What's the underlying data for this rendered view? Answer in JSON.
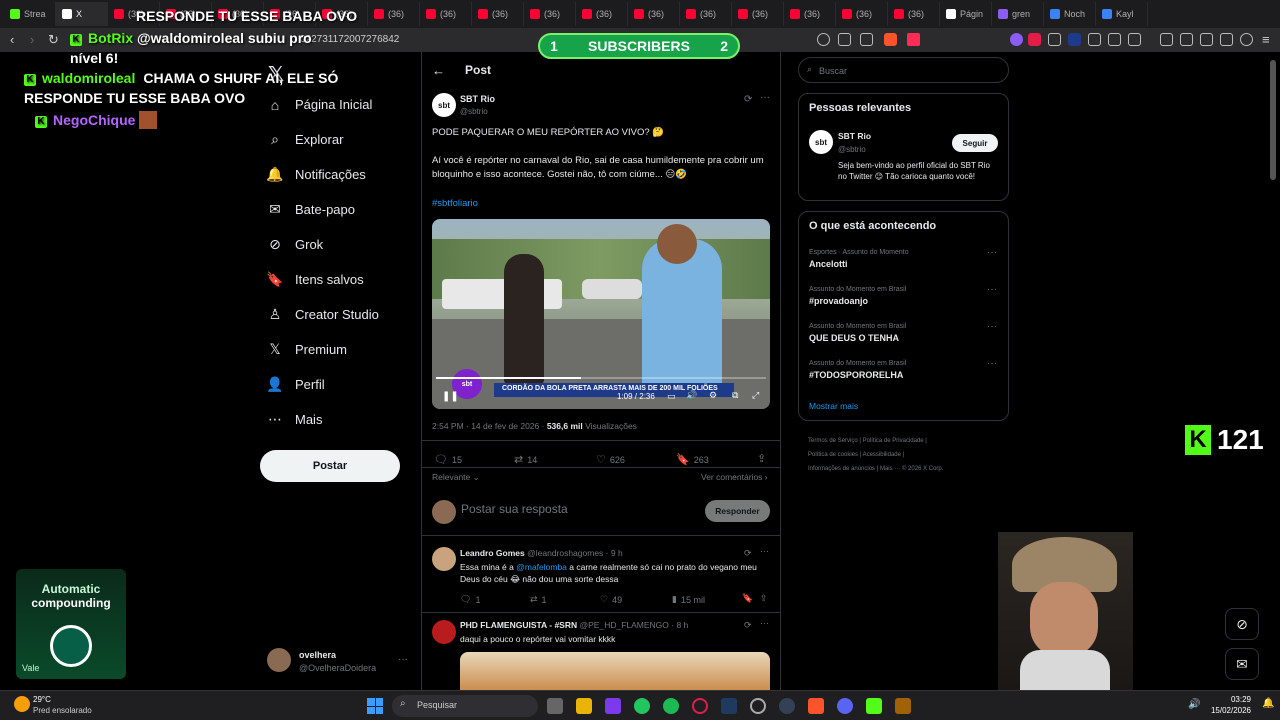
{
  "browser": {
    "tabs": [
      {
        "label": "Strea",
        "color": "#53fc18"
      },
      {
        "label": "X",
        "color": "#ffffff",
        "active": true
      },
      {
        "label": "(36)",
        "color": "#ff0033"
      },
      {
        "label": "(36)",
        "color": "#ff0033"
      },
      {
        "label": "(36)",
        "color": "#ff0033"
      },
      {
        "label": "(36)",
        "color": "#ff0033"
      },
      {
        "label": "(36)",
        "color": "#ff0033"
      },
      {
        "label": "(36)",
        "color": "#ff0033"
      },
      {
        "label": "(36)",
        "color": "#ff0033"
      },
      {
        "label": "(36)",
        "color": "#ff0033"
      },
      {
        "label": "(36)",
        "color": "#ff0033"
      },
      {
        "label": "(36)",
        "color": "#ff0033"
      },
      {
        "label": "(36)",
        "color": "#ff0033"
      },
      {
        "label": "(36)",
        "color": "#ff0033"
      },
      {
        "label": "(36)",
        "color": "#ff0033"
      },
      {
        "label": "(36)",
        "color": "#ff0033"
      },
      {
        "label": "(36)",
        "color": "#ff0033"
      },
      {
        "label": "(36)",
        "color": "#ff0033"
      },
      {
        "label": "Págin",
        "color": "#ffffff"
      },
      {
        "label": "gren",
        "color": "#8b5cf6"
      },
      {
        "label": "Noch",
        "color": "#3b82f6"
      },
      {
        "label": "Kayl",
        "color": "#3b82f6"
      }
    ],
    "url": "022731172007276842"
  },
  "overlay": {
    "chat": [
      {
        "user": "",
        "text": "RESPONDE TU ESSE BABA OVO",
        "color": "#ffffff"
      },
      {
        "user": "BotRix",
        "text": "@waldomiroleal subiu pro nível 6!",
        "color": "#53fc18"
      },
      {
        "user": "waldomiroleal",
        "text": "CHAMA O SHURF AI, ELE SÓ RESPONDE TU ESSE BABA OVO",
        "color": "#53fc18"
      },
      {
        "user": "NegoChique",
        "text": "",
        "color": "#b266ff"
      }
    ],
    "subscribers": {
      "left": "1",
      "label": "SUBSCRIBERS",
      "right": "2"
    },
    "kick_count": "121",
    "promo": {
      "line1": "Automatic",
      "line2": "compounding",
      "brand": "Vale"
    }
  },
  "nav": {
    "items": [
      {
        "label": "Página Inicial",
        "icon": "home-icon"
      },
      {
        "label": "Explorar",
        "icon": "search-icon"
      },
      {
        "label": "Notificações",
        "icon": "bell-icon"
      },
      {
        "label": "Bate-papo",
        "icon": "mail-icon"
      },
      {
        "label": "Grok",
        "icon": "grok-icon"
      },
      {
        "label": "Itens salvos",
        "icon": "bookmark-icon"
      },
      {
        "label": "Creator Studio",
        "icon": "creator-icon"
      },
      {
        "label": "Premium",
        "icon": "x-icon"
      },
      {
        "label": "Perfil",
        "icon": "person-icon"
      },
      {
        "label": "Mais",
        "icon": "more-icon"
      }
    ],
    "post_label": "Postar",
    "account": {
      "name": "ovelhera",
      "handle": "@OvelheraDoidera"
    }
  },
  "post": {
    "header": "Post",
    "author": "SBT Rio",
    "handle": "@sbtrio",
    "text1": "PODE PAQUERAR O MEU REPÓRTER AO VIVO? 🤔",
    "text2": "Aí você é repórter no carnaval do Rio, sai de casa humildemente pra cobrir um bloquinho e isso acontece. Gostei não, tô com ciúme... 😑🤣",
    "hashtag": "#sbtfoliario",
    "video_time": "1:09 / 2:36",
    "video_caption": "CORDÃO DA BOLA PRETA ARRASTA MAIS DE 200 MIL FOLIÕES",
    "video_progress": 0.44,
    "timestamp": "2:54 PM · 14 de fev de 2026 · ",
    "views": "536,6 mil",
    "views_label": " Visualizações",
    "stats": {
      "replies": "15",
      "reposts": "14",
      "likes": "626",
      "bookmarks": "263"
    },
    "sort_label": "Relevante",
    "comments_link": "Ver comentários",
    "reply_placeholder": "Postar sua resposta",
    "reply_button": "Responder"
  },
  "replies": [
    {
      "name": "Leandro Gomes",
      "handle": "@leandroshagomes · 9 h",
      "text_pre": "Essa mina é a ",
      "mention": "@mafelomba",
      "text_post": " a carne realmente só cai no prato do vegano meu Deus do céu 😂 não dou uma sorte dessa",
      "replies": "1",
      "reposts": "1",
      "likes": "49",
      "views": "15 mil"
    },
    {
      "name": "PHD FLAMENGUISTA - #SRN",
      "handle": "@PE_HD_FLAMENGO · 8 h",
      "text_pre": "daqui a pouco o repórter vai vomitar kkkk",
      "mention": "",
      "text_post": ""
    }
  ],
  "right": {
    "search_placeholder": "Buscar",
    "relevant_title": "Pessoas relevantes",
    "relevant": {
      "name": "SBT Rio",
      "handle": "@sbtrio",
      "bio": "Seja bem-vindo ao perfil oficial do SBT Rio no Twitter 😉 Tão carioca quanto você!",
      "follow": "Seguir"
    },
    "trends_title": "O que está acontecendo",
    "trends": [
      {
        "sub": "Esportes · Assunto do Momento",
        "title": "Ancelotti"
      },
      {
        "sub": "Assunto do Momento em Brasil",
        "title": "#provadoanjo"
      },
      {
        "sub": "Assunto do Momento em Brasil",
        "title": "QUE DEUS O TENHA"
      },
      {
        "sub": "Assunto do Momento em Brasil",
        "title": "#TODOSPORORELHA"
      }
    ],
    "show_more": "Mostrar mais",
    "footer": [
      "Termos de Serviço",
      "Política de Privacidade",
      "Política de cookies",
      "Acessibilidade",
      "Informações de anúncios",
      "Mais ···",
      "© 2026 X Corp."
    ]
  },
  "taskbar": {
    "weather_temp": "29°C",
    "weather_desc": "Pred ensolarado",
    "search": "Pesquisar",
    "time": "03:29",
    "date": "15/02/2026"
  }
}
